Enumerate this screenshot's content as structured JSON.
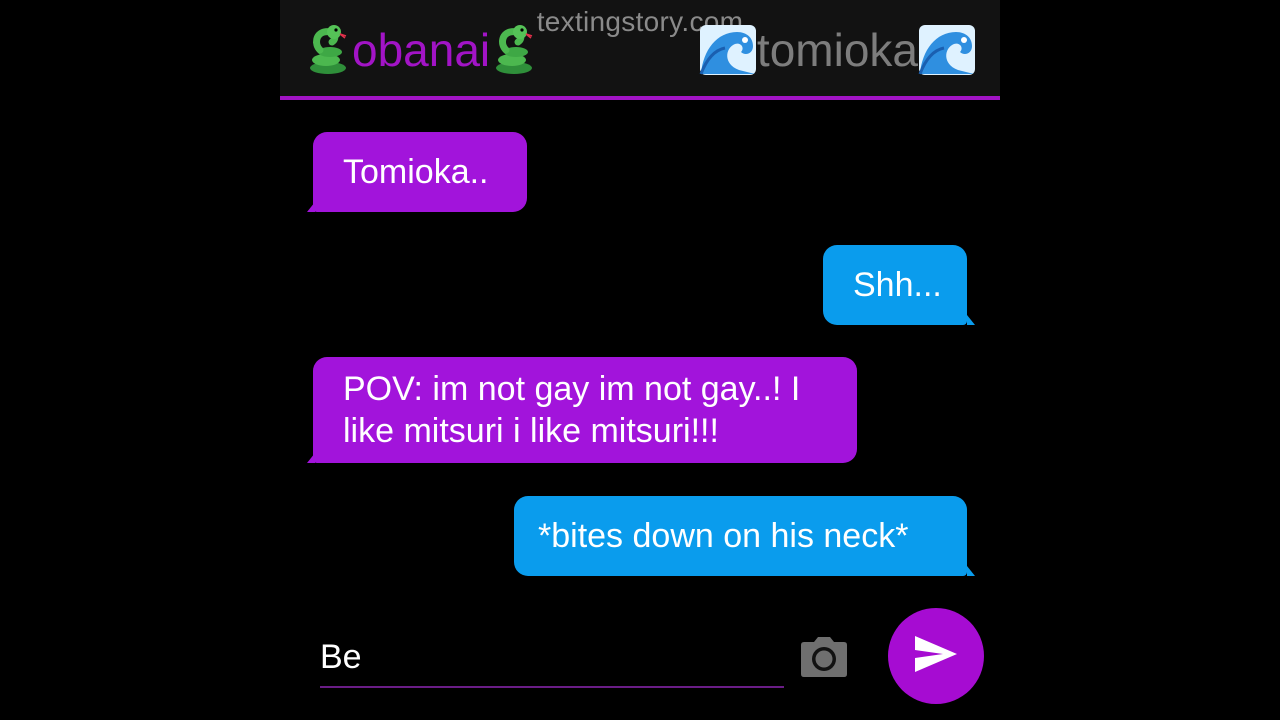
{
  "watermark": "textingstory.com",
  "header": {
    "left_name": "obanai",
    "left_icon": "snake-icon",
    "right_name": "tomioka",
    "right_icon": "water-wave-icon",
    "accent_color": "#a214c6"
  },
  "messages": [
    {
      "side": "left",
      "text": "Tomioka.."
    },
    {
      "side": "right",
      "text": "Shh..."
    },
    {
      "side": "left",
      "text": "POV: im not gay im not gay..! I\nlike mitsuri i like mitsuri!!!"
    },
    {
      "side": "right",
      "text": "*bites down on his neck*"
    }
  ],
  "composer": {
    "input_value": "Be",
    "camera_icon": "camera-icon",
    "send_icon": "send-icon"
  },
  "colors": {
    "left_bubble": "#a214db",
    "right_bubble": "#0a9ced",
    "send_button": "#a60cd2"
  }
}
